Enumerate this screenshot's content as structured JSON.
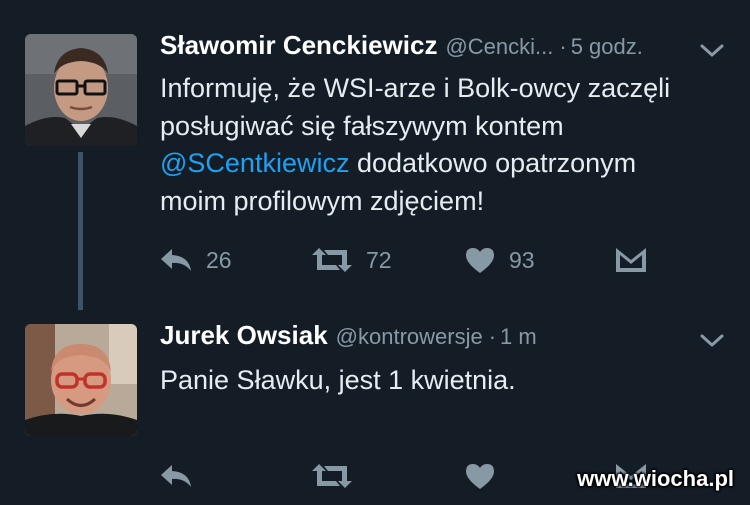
{
  "tweets": [
    {
      "name": "Sławomir Cenckiewicz",
      "handle": "@Cencki...",
      "dot": "·",
      "time": "5 godz.",
      "text_lines": [
        "Informuję, że WSI-arze i Bolk-owcy zaczęli",
        "posługiwać się fałszywym kontem"
      ],
      "mention": "@SCentkiewicz",
      "text_after_mention": " dodatkowo opatrzonym",
      "text_last": "moim profilowym zdjęciem!",
      "replies": "26",
      "retweets": "72",
      "likes": "93"
    },
    {
      "name": "Jurek Owsiak",
      "handle": "@kontrowersje",
      "dot": "·",
      "time": "1 m",
      "text": "Panie Sławku, jest 1 kwietnia."
    }
  ],
  "icons": {
    "reply": "reply-icon",
    "retweet": "retweet-icon",
    "like": "heart-icon",
    "dm": "direct-message-icon",
    "more": "chevron-down-icon"
  },
  "colors": {
    "background": "#141d26",
    "text": "#e6ecf0",
    "muted": "#8899a6",
    "link": "#1da1f2"
  },
  "watermark": "www.wiocha.pl"
}
